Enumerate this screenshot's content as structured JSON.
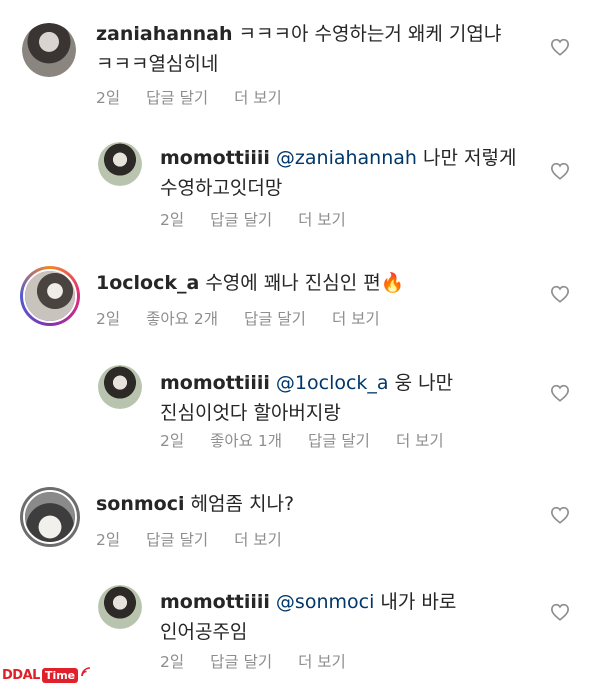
{
  "comments": [
    {
      "username": "zaniahannah",
      "text_lines": [
        "ㅋㅋㅋ아 수영하는거 왜케 기엽냐",
        "ㅋㅋㅋ열심히네"
      ],
      "time": "2일",
      "reply": "답글 달기",
      "more": "더 보기"
    },
    {
      "username": "momottiiii",
      "mention": "@zaniahannah",
      "text_lines": [
        "나만 저렇게",
        "수영하고잇더망"
      ],
      "time": "2일",
      "reply": "답글 달기",
      "more": "더 보기"
    },
    {
      "username": "1oclock_a",
      "text_lines": [
        "수영에 꽤나 진심인 편🔥"
      ],
      "time": "2일",
      "likes": "좋아요 2개",
      "reply": "답글 달기",
      "more": "더 보기"
    },
    {
      "username": "momottiiii",
      "mention": "@1oclock_a",
      "text_lines": [
        "웅 나만",
        "진심이엇다 할아버지랑"
      ],
      "time": "2일",
      "likes": "좋아요 1개",
      "reply": "답글 달기",
      "more": "더 보기"
    },
    {
      "username": "sonmoci",
      "text_lines": [
        "헤엄좀 치나?"
      ],
      "time": "2일",
      "reply": "답글 달기",
      "more": "더 보기"
    },
    {
      "username": "momottiiii",
      "mention": "@sonmoci",
      "text_lines": [
        "내가 바로",
        "인어공주임"
      ],
      "time": "2일",
      "reply": "답글 달기",
      "more": "더 보기"
    }
  ],
  "watermark": {
    "brand": "DDAL",
    "suffix": "Time"
  },
  "icons": {
    "like": "heart-outline-icon",
    "avatar": "user-avatar"
  },
  "colors": {
    "mention": "#00376b",
    "meta": "#8e8e8e",
    "watermark": "#e0202a"
  }
}
